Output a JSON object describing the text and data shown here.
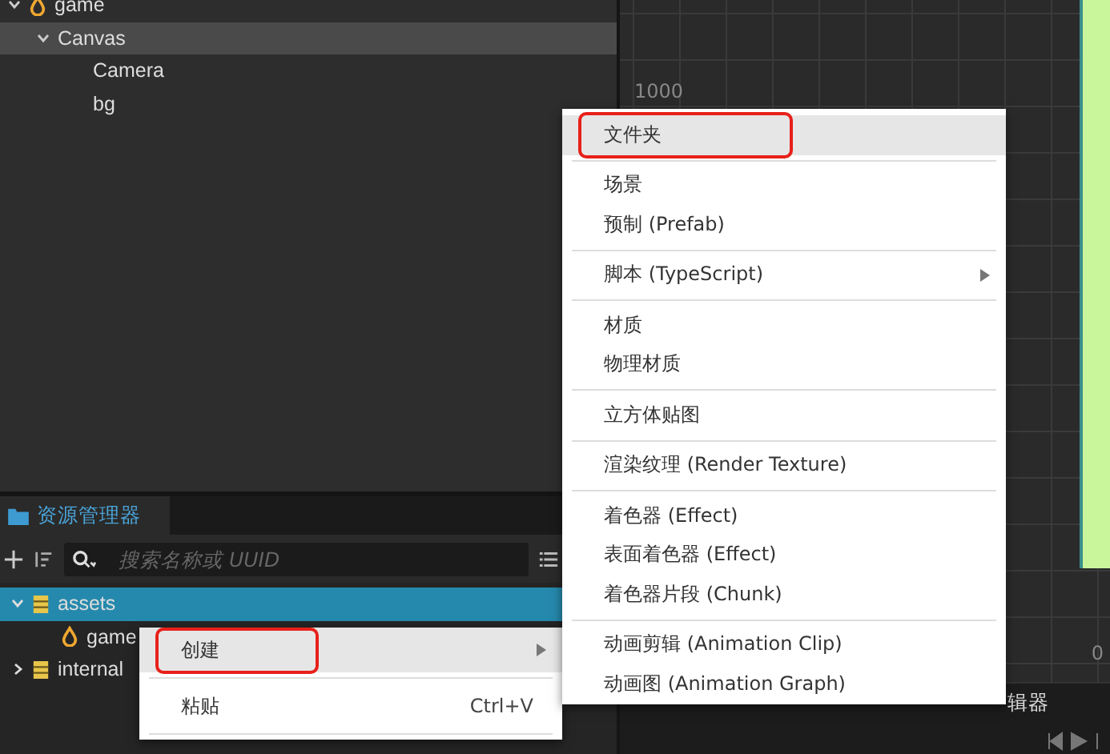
{
  "hierarchy": {
    "items": [
      {
        "label": "game",
        "kind": "scene",
        "expanded": true,
        "selected": false,
        "children": [
          {
            "label": "Canvas",
            "expanded": true,
            "selected": true,
            "children": [
              {
                "label": "Camera",
                "kind": "node",
                "selected": false
              },
              {
                "label": "bg",
                "kind": "node",
                "selected": false
              }
            ]
          }
        ]
      }
    ]
  },
  "scene": {
    "axis_labels": [
      "1000",
      "0"
    ],
    "bottom_tab": "辑器"
  },
  "assets_panel": {
    "tab": "资源管理器",
    "search": {
      "placeholder": "搜索名称或 UUID"
    },
    "items": [
      {
        "label": "assets",
        "kind": "bundle",
        "expanded": true,
        "selected": true,
        "children": [
          {
            "label": "game",
            "kind": "scene",
            "selected": false
          }
        ]
      },
      {
        "label": "internal",
        "kind": "bundle",
        "expanded": false,
        "selected": false
      }
    ]
  },
  "context_menu": {
    "groups": [
      [
        {
          "label": "创建",
          "submenu": true,
          "selected": true,
          "marked": true
        }
      ],
      [
        {
          "label": "粘贴",
          "shortcut": "Ctrl+V",
          "submenu": false,
          "selected": false,
          "marked": false
        }
      ]
    ]
  },
  "create_submenu": {
    "groups": [
      [
        {
          "label": "文件夹",
          "submenu": false,
          "selected": true,
          "marked": true
        }
      ],
      [
        {
          "label": "场景",
          "submenu": false,
          "selected": false,
          "marked": false
        },
        {
          "label": "预制 (Prefab)",
          "submenu": false,
          "selected": false,
          "marked": false
        }
      ],
      [
        {
          "label": "脚本 (TypeScript)",
          "submenu": true,
          "selected": false,
          "marked": false
        }
      ],
      [
        {
          "label": "材质",
          "submenu": false,
          "selected": false,
          "marked": false
        },
        {
          "label": "物理材质",
          "submenu": false,
          "selected": false,
          "marked": false
        }
      ],
      [
        {
          "label": "立方体贴图",
          "submenu": false,
          "selected": false,
          "marked": false
        }
      ],
      [
        {
          "label": "渲染纹理 (Render Texture)",
          "submenu": false,
          "selected": false,
          "marked": false
        }
      ],
      [
        {
          "label": "着色器 (Effect)",
          "submenu": false,
          "selected": false,
          "marked": false
        },
        {
          "label": "表面着色器 (Effect)",
          "submenu": false,
          "selected": false,
          "marked": false
        },
        {
          "label": "着色器片段 (Chunk)",
          "submenu": false,
          "selected": false,
          "marked": false
        }
      ],
      [
        {
          "label": "动画剪辑 (Animation Clip)",
          "submenu": false,
          "selected": false,
          "marked": false
        },
        {
          "label": "动画图 (Animation Graph)",
          "submenu": false,
          "selected": false,
          "marked": false
        }
      ]
    ]
  }
}
